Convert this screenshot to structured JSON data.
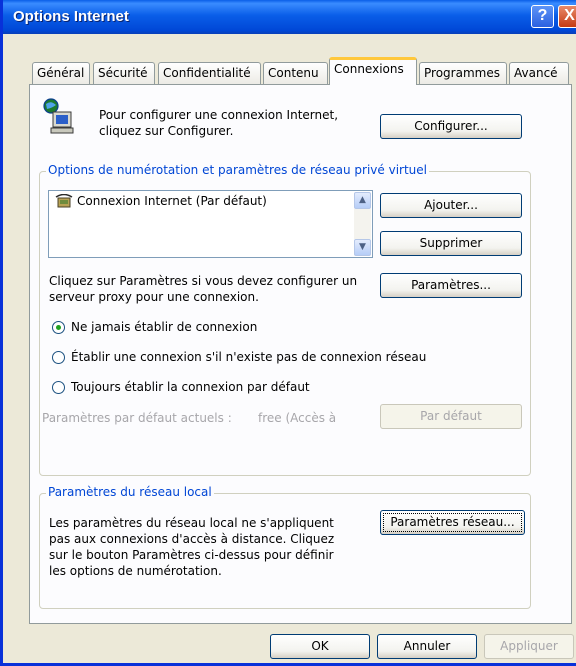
{
  "window": {
    "title": "Options Internet",
    "help_glyph": "?",
    "close_glyph": "X"
  },
  "tabs": [
    {
      "label": "Général"
    },
    {
      "label": "Sécurité"
    },
    {
      "label": "Confidentialité"
    },
    {
      "label": "Contenu"
    },
    {
      "label": "Connexions",
      "active": true
    },
    {
      "label": "Programmes"
    },
    {
      "label": "Avancé"
    }
  ],
  "setup": {
    "text_line1": "Pour configurer une connexion Internet,",
    "text_line2": "cliquez sur Configurer.",
    "configure_button": "Configurer...",
    "icon": "network-computer-icon"
  },
  "dialup": {
    "group_title": "Options de numérotation et paramètres de réseau privé virtuel",
    "connections": [
      {
        "label": "Connexion Internet (Par défaut)",
        "icon": "dialup-connection-icon"
      }
    ],
    "add_button": "Ajouter...",
    "remove_button": "Supprimer",
    "settings_text_line1": "Cliquez sur Paramètres si vous devez configurer un",
    "settings_text_line2": "serveur proxy pour une connexion.",
    "settings_button": "Paramètres...",
    "radio_options": [
      {
        "label": "Ne jamais établir de connexion",
        "selected": true
      },
      {
        "label": "Établir une connexion s'il n'existe pas de connexion réseau",
        "selected": false
      },
      {
        "label": "Toujours établir la connexion par défaut",
        "selected": false
      }
    ],
    "current_default_label": "Paramètres par défaut actuels :",
    "current_default_value": "free (Accès à",
    "set_default_button": "Par défaut"
  },
  "lan": {
    "group_title": "Paramètres du réseau local",
    "text_lines": [
      "Les paramètres du réseau local ne s'appliquent",
      "pas aux connexions d'accès à distance. Cliquez",
      "sur le bouton Paramètres ci-dessus pour définir",
      "les options de numérotation."
    ],
    "lan_settings_button": "Paramètres réseau..."
  },
  "footer": {
    "ok_button": "OK",
    "cancel_button": "Annuler",
    "apply_button": "Appliquer"
  },
  "colors": {
    "title_bar": "#0a5ee8",
    "group_title": "#0046d5",
    "active_tab_accent": "#ffc83c",
    "radio_dot": "#21a121"
  }
}
